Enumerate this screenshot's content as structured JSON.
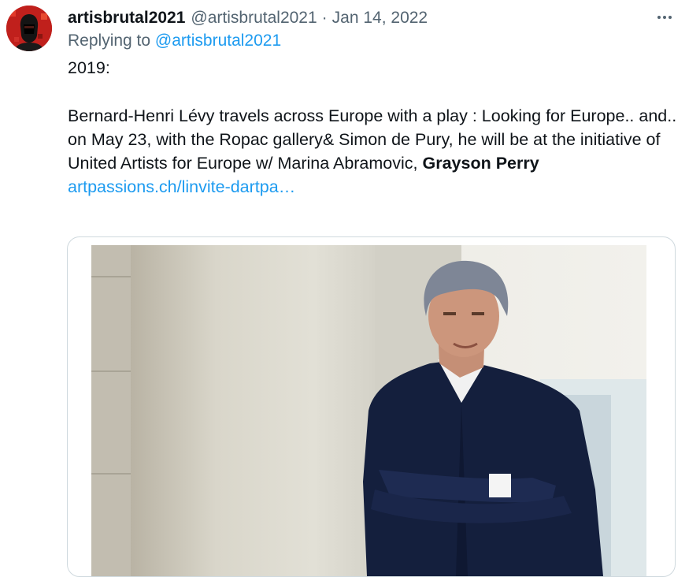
{
  "tweet": {
    "display_name": "artisbrutal2021",
    "handle": "@artisbrutal2021",
    "separator": "·",
    "date": "Jan 14, 2022",
    "more_icon": "more-horizontal-icon",
    "replying_prefix": "Replying to",
    "replying_to": "@artisbrutal2021",
    "body_year": "2019:",
    "body_main": "Bernard-Henri Lévy travels across Europe with a play : Looking for Europe.. and.. on May 23, with the Ropac gallery& Simon de Pury, he will be at the initiative of United Artists for Europe w/ Marina Abramovic,",
    "body_bold": "Grayson Perry",
    "link_text": "artpassions.ch/linvite-dartpa…"
  },
  "colors": {
    "link": "#1d9bf0",
    "secondary_text": "#536471",
    "primary_text": "#0f1419",
    "card_border": "#cfd9de",
    "avatar_bg": "#c0201c"
  }
}
